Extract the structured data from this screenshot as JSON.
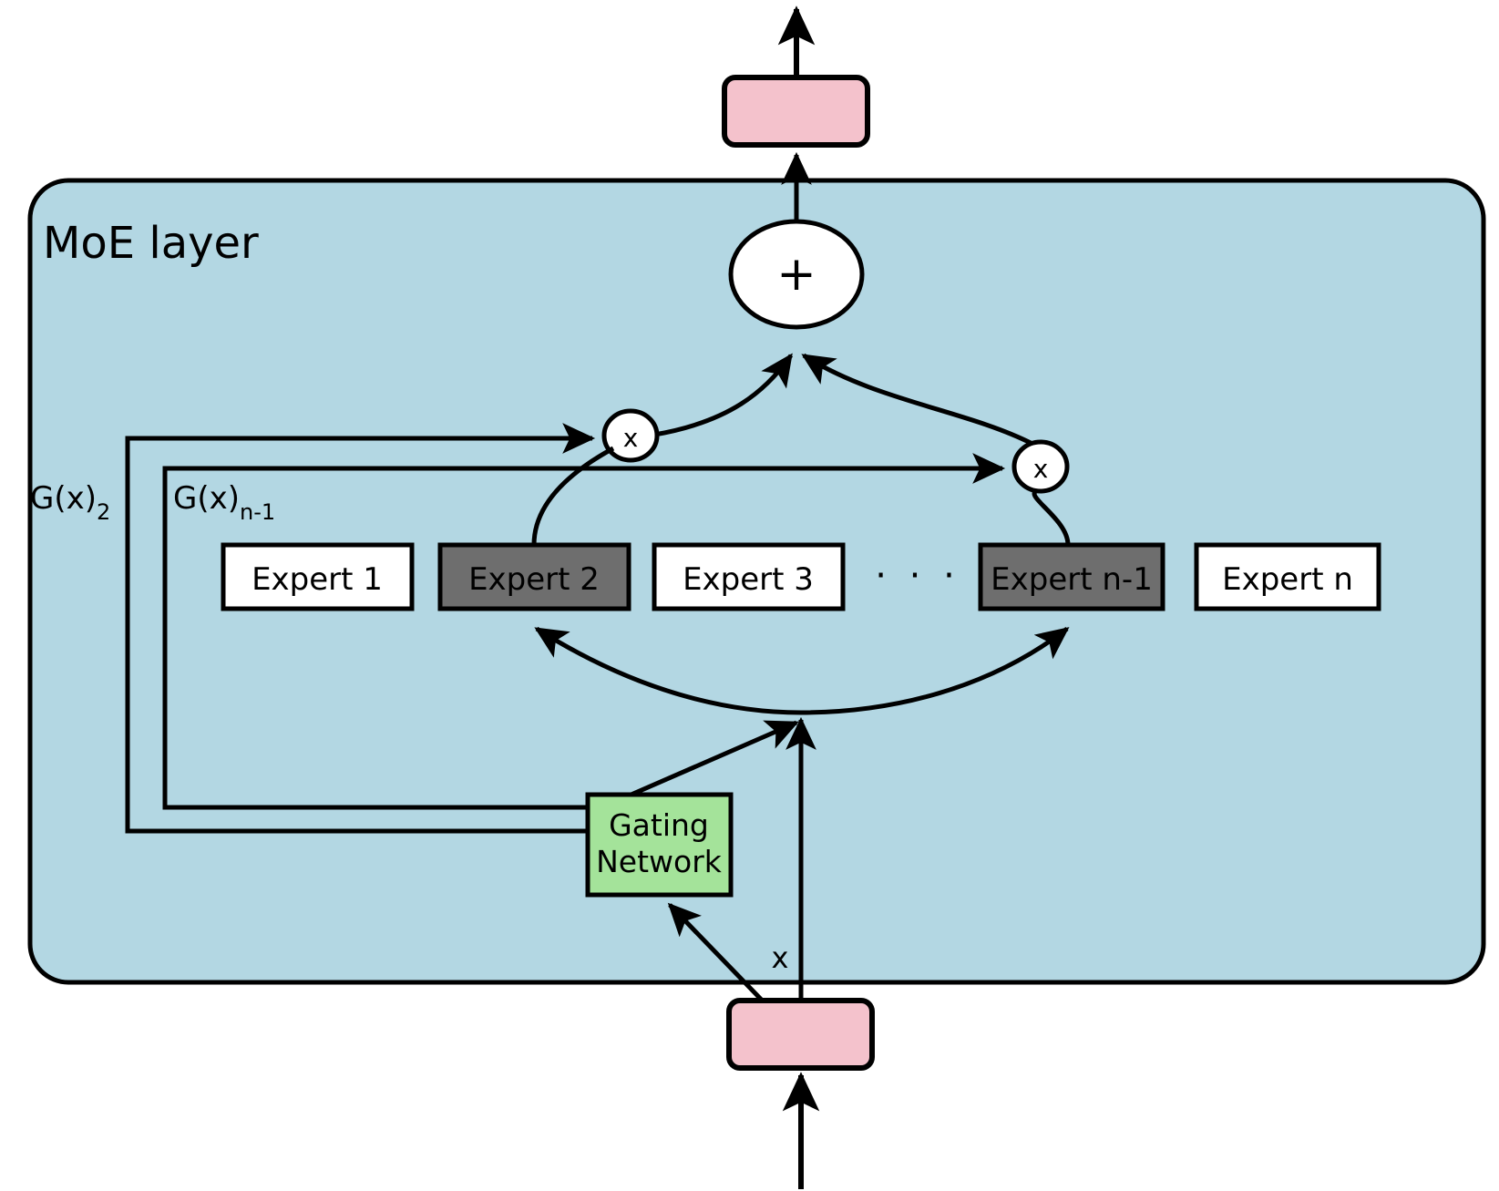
{
  "diagram": {
    "title": "MoE layer",
    "container_label": "MoE layer",
    "colors": {
      "moe_layer_fill": "#b3d7e3",
      "moe_layer_stroke": "#000000",
      "expert_inactive_fill": "#ffffff",
      "expert_active_fill": "#6e6e6e",
      "gating_fill": "#a4e39a",
      "io_block_fill": "#f4c2cc",
      "node_fill": "#ffffff",
      "line": "#000000"
    },
    "io_blocks": [
      {
        "name": "output-block",
        "label": ""
      },
      {
        "name": "input-block",
        "label": ""
      }
    ],
    "nodes": {
      "sum": {
        "label": "+"
      },
      "multiply_left": {
        "label": "x"
      },
      "multiply_right": {
        "label": "x"
      }
    },
    "gating": {
      "label_line1": "Gating",
      "label_line2": "Network"
    },
    "input_signal_label": "x",
    "gate_labels": [
      {
        "name": "gate-weight-2",
        "text": "G(x)",
        "subscript": "2"
      },
      {
        "name": "gate-weight-n-1",
        "text": "G(x)",
        "subscript": "n-1"
      }
    ],
    "experts": [
      {
        "label": "Expert 1",
        "active": false
      },
      {
        "label": "Expert 2",
        "active": true
      },
      {
        "label": "Expert 3",
        "active": false
      },
      {
        "label": "Expert n-1",
        "active": true
      },
      {
        "label": "Expert n",
        "active": false
      }
    ],
    "ellipsis": "· · ·"
  }
}
